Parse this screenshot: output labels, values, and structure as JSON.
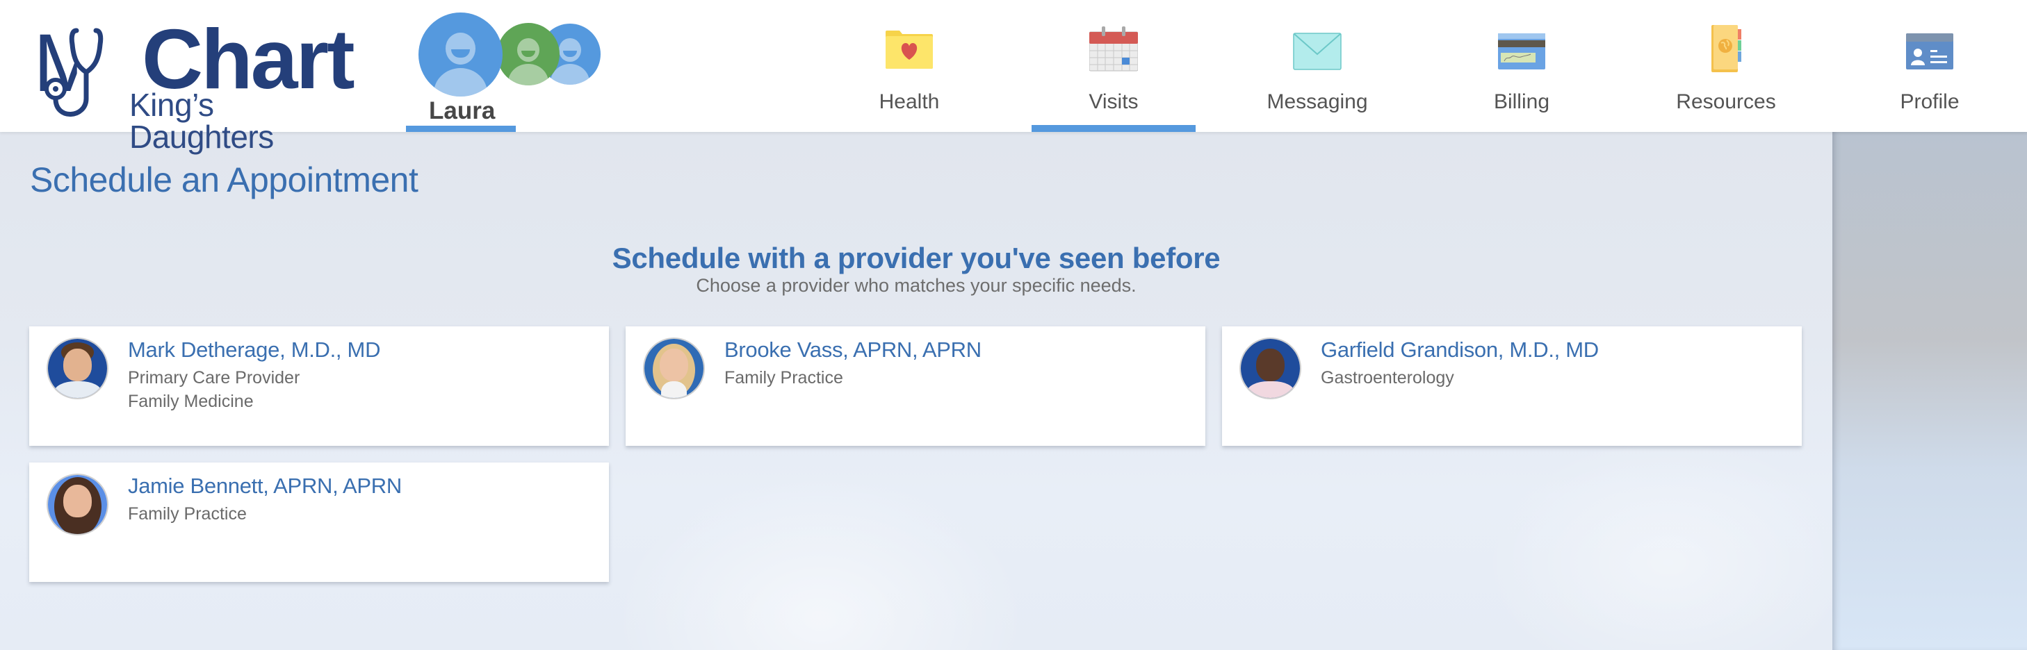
{
  "brand": {
    "logo_main_prefix": "My",
    "logo_main": "Chart",
    "logo_sub": "King’s Daughters",
    "color_primary": "#243f7a"
  },
  "patient": {
    "name": "Laura",
    "avatar_colors": [
      "#5599de",
      "#5fa556",
      "#5599de"
    ]
  },
  "nav": {
    "active": "Visits",
    "accent_color": "#5599de",
    "items": [
      {
        "label": "Health",
        "icon": "health-folder-icon"
      },
      {
        "label": "Visits",
        "icon": "calendar-icon"
      },
      {
        "label": "Messaging",
        "icon": "envelope-icon"
      },
      {
        "label": "Billing",
        "icon": "credit-card-icon"
      },
      {
        "label": "Resources",
        "icon": "address-book-globe-icon"
      },
      {
        "label": "Profile",
        "icon": "id-card-icon"
      }
    ]
  },
  "page": {
    "title": "Schedule an Appointment",
    "section_title": "Schedule with a provider you've seen before",
    "section_subtitle": "Choose a provider who matches your specific needs."
  },
  "providers": [
    {
      "name": "Mark Detherage, M.D., MD",
      "lines": [
        "Primary Care Provider",
        "Family Medicine"
      ]
    },
    {
      "name": "Brooke Vass, APRN, APRN",
      "lines": [
        "Family Practice"
      ]
    },
    {
      "name": "Garfield Grandison, M.D., MD",
      "lines": [
        "Gastroenterology"
      ]
    },
    {
      "name": "Jamie Bennett, APRN, APRN",
      "lines": [
        "Family Practice"
      ]
    }
  ]
}
